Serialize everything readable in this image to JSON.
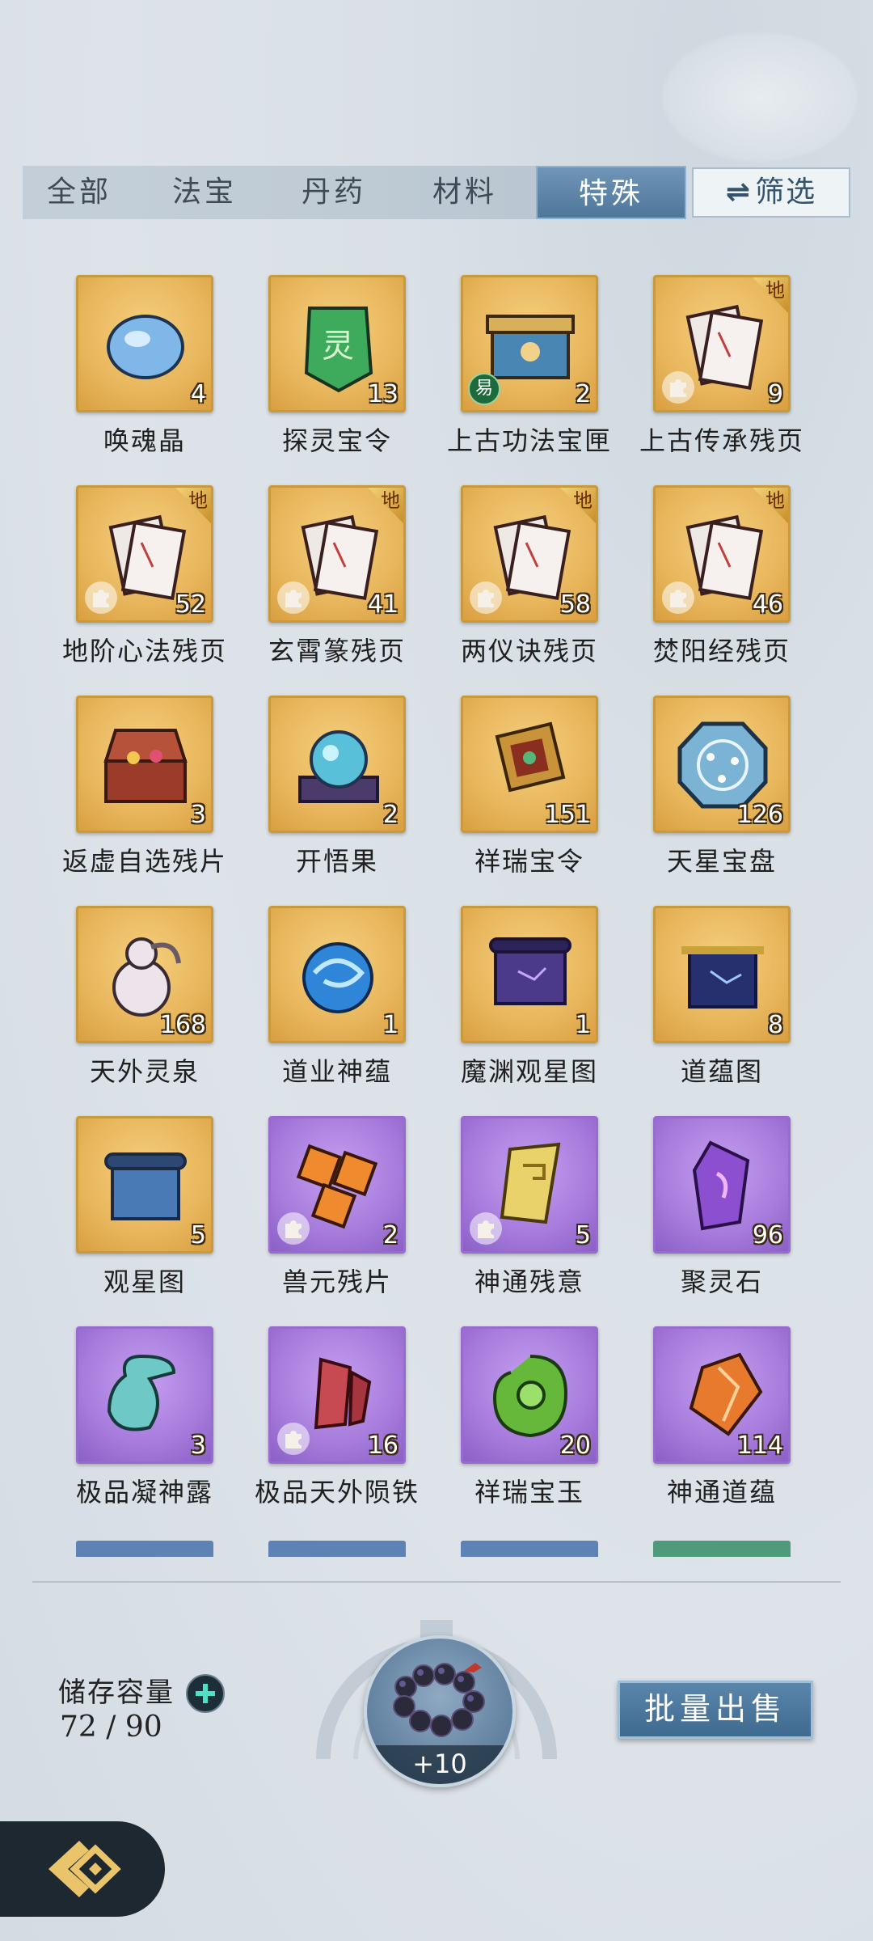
{
  "tabs": {
    "items": [
      {
        "label": "全部",
        "active": false
      },
      {
        "label": "法宝",
        "active": false
      },
      {
        "label": "丹药",
        "active": false
      },
      {
        "label": "材料",
        "active": false
      },
      {
        "label": "特殊",
        "active": true
      }
    ],
    "filter_label": "筛选",
    "filter_icon": "swap-arrows-icon"
  },
  "items": [
    {
      "name": "唤魂晶",
      "count": "4",
      "rarity": "gold",
      "icon": "blue-crystal-icon"
    },
    {
      "name": "探灵宝令",
      "count": "13",
      "rarity": "gold",
      "icon": "green-token-icon"
    },
    {
      "name": "上古功法宝匣",
      "count": "2",
      "rarity": "gold",
      "icon": "treasure-box-icon",
      "tag": "易"
    },
    {
      "name": "上古传承残页",
      "count": "9",
      "rarity": "gold",
      "icon": "scroll-page-icon",
      "corner": "地",
      "fragment": true
    },
    {
      "name": "地阶心法残页",
      "count": "52",
      "rarity": "gold",
      "icon": "scroll-page-icon",
      "corner": "地",
      "fragment": true
    },
    {
      "name": "玄霄篆残页",
      "count": "41",
      "rarity": "gold",
      "icon": "scroll-page-icon",
      "corner": "地",
      "fragment": true
    },
    {
      "name": "两仪诀残页",
      "count": "58",
      "rarity": "gold",
      "icon": "scroll-page-icon",
      "corner": "地",
      "fragment": true
    },
    {
      "name": "焚阳经残页",
      "count": "46",
      "rarity": "gold",
      "icon": "scroll-page-icon",
      "corner": "地",
      "fragment": true
    },
    {
      "name": "返虚自选残片",
      "count": "3",
      "rarity": "gold",
      "icon": "open-chest-icon"
    },
    {
      "name": "开悟果",
      "count": "2",
      "rarity": "gold",
      "icon": "glowing-fruit-icon"
    },
    {
      "name": "祥瑞宝令",
      "count": "151",
      "rarity": "gold",
      "icon": "auspicious-token-icon"
    },
    {
      "name": "天星宝盘",
      "count": "126",
      "rarity": "gold",
      "icon": "star-disc-icon"
    },
    {
      "name": "天外灵泉",
      "count": "168",
      "rarity": "gold",
      "icon": "spring-gourd-icon"
    },
    {
      "name": "道业神蕴",
      "count": "1",
      "rarity": "gold",
      "icon": "blue-orb-icon"
    },
    {
      "name": "魔渊观星图",
      "count": "1",
      "rarity": "gold",
      "icon": "purple-star-map-icon"
    },
    {
      "name": "道蕴图",
      "count": "8",
      "rarity": "gold",
      "icon": "dao-map-icon"
    },
    {
      "name": "观星图",
      "count": "5",
      "rarity": "gold",
      "icon": "star-map-icon"
    },
    {
      "name": "兽元残片",
      "count": "2",
      "rarity": "purple",
      "icon": "beast-fragment-icon",
      "fragment": true
    },
    {
      "name": "神通残意",
      "count": "5",
      "rarity": "purple",
      "icon": "golden-shard-icon",
      "fragment": true
    },
    {
      "name": "聚灵石",
      "count": "96",
      "rarity": "purple",
      "icon": "purple-gem-icon"
    },
    {
      "name": "极品凝神露",
      "count": "3",
      "rarity": "purple",
      "icon": "dew-vase-icon"
    },
    {
      "name": "极品天外陨铁",
      "count": "16",
      "rarity": "purple",
      "icon": "meteor-iron-icon",
      "fragment": true
    },
    {
      "name": "祥瑞宝玉",
      "count": "20",
      "rarity": "purple",
      "icon": "green-jade-icon"
    },
    {
      "name": "神通道蕴",
      "count": "114",
      "rarity": "purple",
      "icon": "amber-crystal-icon"
    }
  ],
  "storage": {
    "label": "储存容量",
    "value": "72 / 90",
    "used": 72,
    "capacity": 90
  },
  "expand": {
    "label": "+10",
    "icon": "bead-bracelet-icon"
  },
  "sell_button": "批量出售",
  "back_icon": "back-arrow-icon",
  "colors": {
    "gold_tile": "#e8b65c",
    "purple_tile": "#a67bdc",
    "active_tab": "#5a82a6",
    "accent": "#4fe0c8"
  }
}
